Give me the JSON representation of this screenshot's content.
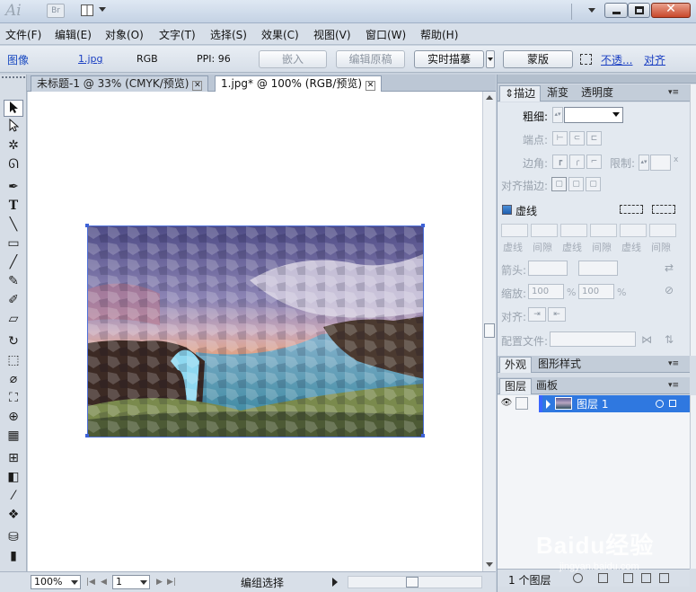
{
  "titlebar": {
    "app_logo": "Ai",
    "bridge_label": "Br",
    "icons": [
      "arrange-documents-icon",
      "workspace-switcher-icon",
      "minimize-icon",
      "maximize-icon",
      "close-icon"
    ]
  },
  "menubar": {
    "items": [
      {
        "label": "文件(F)"
      },
      {
        "label": "编辑(E)"
      },
      {
        "label": "对象(O)"
      },
      {
        "label": "文字(T)"
      },
      {
        "label": "选择(S)"
      },
      {
        "label": "效果(C)"
      },
      {
        "label": "视图(V)"
      },
      {
        "label": "窗口(W)"
      },
      {
        "label": "帮助(H)"
      }
    ]
  },
  "controlbar": {
    "selection_type": "图像",
    "filename": "1.jpg",
    "color_mode": "RGB",
    "ppi": "PPI: 96",
    "embed_label": "嵌入",
    "edit_original_label": "编辑原稿",
    "live_trace_label": "实时描摹",
    "mask_label": "蒙版",
    "opacity_link": "不透...",
    "align_link": "对齐"
  },
  "document_tabs": [
    {
      "label": "未标题-1 @ 33% (CMYK/预览)",
      "active": false
    },
    {
      "label": "1.jpg* @ 100% (RGB/预览)",
      "active": true
    }
  ],
  "statusbar": {
    "zoom": "100%",
    "artboard": "1",
    "status_text": "编组选择"
  },
  "stroke_panel": {
    "tabs": [
      "描边",
      "渐变",
      "透明度"
    ],
    "weight_label": "粗细:",
    "cap_label": "端点:",
    "corner_label": "边角:",
    "limit_label": "限制:",
    "align_label": "对齐描边:",
    "limit_x": "x",
    "dashed_label": "虚线",
    "dash_labels": [
      "虚线",
      "间隙",
      "虚线",
      "间隙",
      "虚线",
      "间隙"
    ],
    "arrowheads_label": "箭头:",
    "scale_label": "缩放:",
    "scale_start": "100",
    "scale_end": "100",
    "percent": "%",
    "arrow_align_label": "对齐:",
    "profile_label": "配置文件:"
  },
  "appearance_panel": {
    "tabs": [
      "外观",
      "图形样式"
    ]
  },
  "layers_panel": {
    "tabs": [
      "图层",
      "画板"
    ],
    "layers": [
      {
        "name": "图层 1",
        "visible": true,
        "selected": true
      }
    ],
    "layer_count": "1 个图层"
  },
  "watermark": {
    "main": "Baidu经验",
    "sub": "jingyan.baidu.com"
  },
  "colors": {
    "selection_blue": "#2f78e0",
    "bounding_box": "#4d6fd6",
    "link_blue": "#1a3fc2"
  }
}
